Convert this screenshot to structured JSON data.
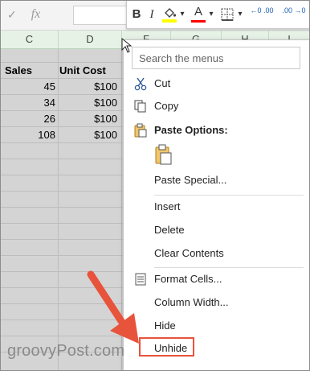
{
  "formula_bar": {
    "cancel_glyph": "✓",
    "fx_label": "fx"
  },
  "columns": [
    "C",
    "D",
    "F",
    "G",
    "H",
    "I"
  ],
  "table": {
    "headers": [
      "Sales",
      "Unit Cost"
    ],
    "rows": [
      [
        "45",
        "$100"
      ],
      [
        "34",
        "$100"
      ],
      [
        "26",
        "$100"
      ],
      [
        "108",
        "$100"
      ]
    ]
  },
  "mini_toolbar": {
    "bold": "B",
    "italic": "I",
    "font_color_letter": "A",
    "fill_accent": "#ffff00",
    "font_accent": "#ff0000",
    "decimal_increase": "←0 .00",
    "decimal_decrease": ".00 →0"
  },
  "context_menu": {
    "search_placeholder": "Search the menus",
    "items": {
      "cut": "Cut",
      "copy": "Copy",
      "paste_options": "Paste Options:",
      "paste_special": "Paste Special...",
      "insert": "Insert",
      "delete": "Delete",
      "clear_contents": "Clear Contents",
      "format_cells": "Format Cells...",
      "column_width": "Column Width...",
      "hide": "Hide",
      "unhide": "Unhide"
    },
    "highlight_color": "#e8533c"
  },
  "watermark": "groovyPost.com"
}
